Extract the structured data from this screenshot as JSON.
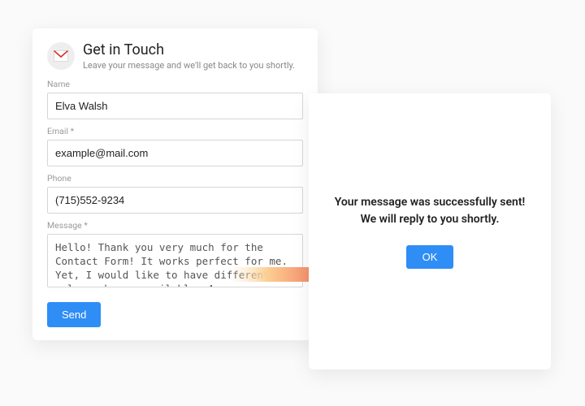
{
  "form": {
    "title": "Get in Touch",
    "subtitle": "Leave your message and we'll get back to you shortly.",
    "labels": {
      "name": "Name",
      "email": "Email *",
      "phone": "Phone",
      "message": "Message *"
    },
    "values": {
      "name": "Elva Walsh",
      "email": "example@mail.com",
      "phone": "(715)552-9234",
      "message": "Hello! Thank you very much for the Contact Form! It works perfect for me. Yet, I would like to have different color schemes available. Are you planning this update?"
    },
    "send_label": "Send",
    "icon": "mail-icon"
  },
  "success": {
    "text": "Your message was successfully sent! We will reply to you shortly.",
    "ok_label": "OK"
  },
  "arrow": {
    "gradient_start": "#fde2b8",
    "gradient_end": "#f0544f"
  },
  "colors": {
    "primary": "#2f8df6"
  }
}
